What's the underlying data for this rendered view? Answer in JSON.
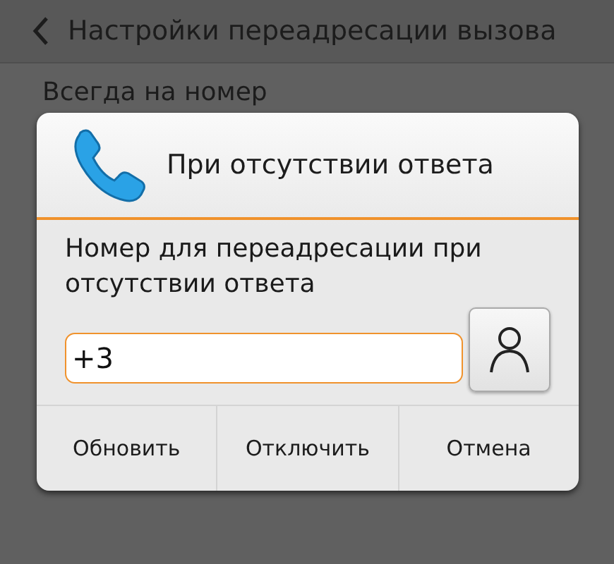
{
  "app_bar": {
    "title": "Настройки переадресации вызова"
  },
  "settings": [
    {
      "title": "Всегда на номер"
    }
  ],
  "dialog": {
    "title": "При отсутствии ответа",
    "message": "Номер для переадресации при отсутствии ответа",
    "number_field": {
      "value": "+3"
    },
    "buttons": [
      "Обновить",
      "Отключить",
      "Отмена"
    ]
  }
}
